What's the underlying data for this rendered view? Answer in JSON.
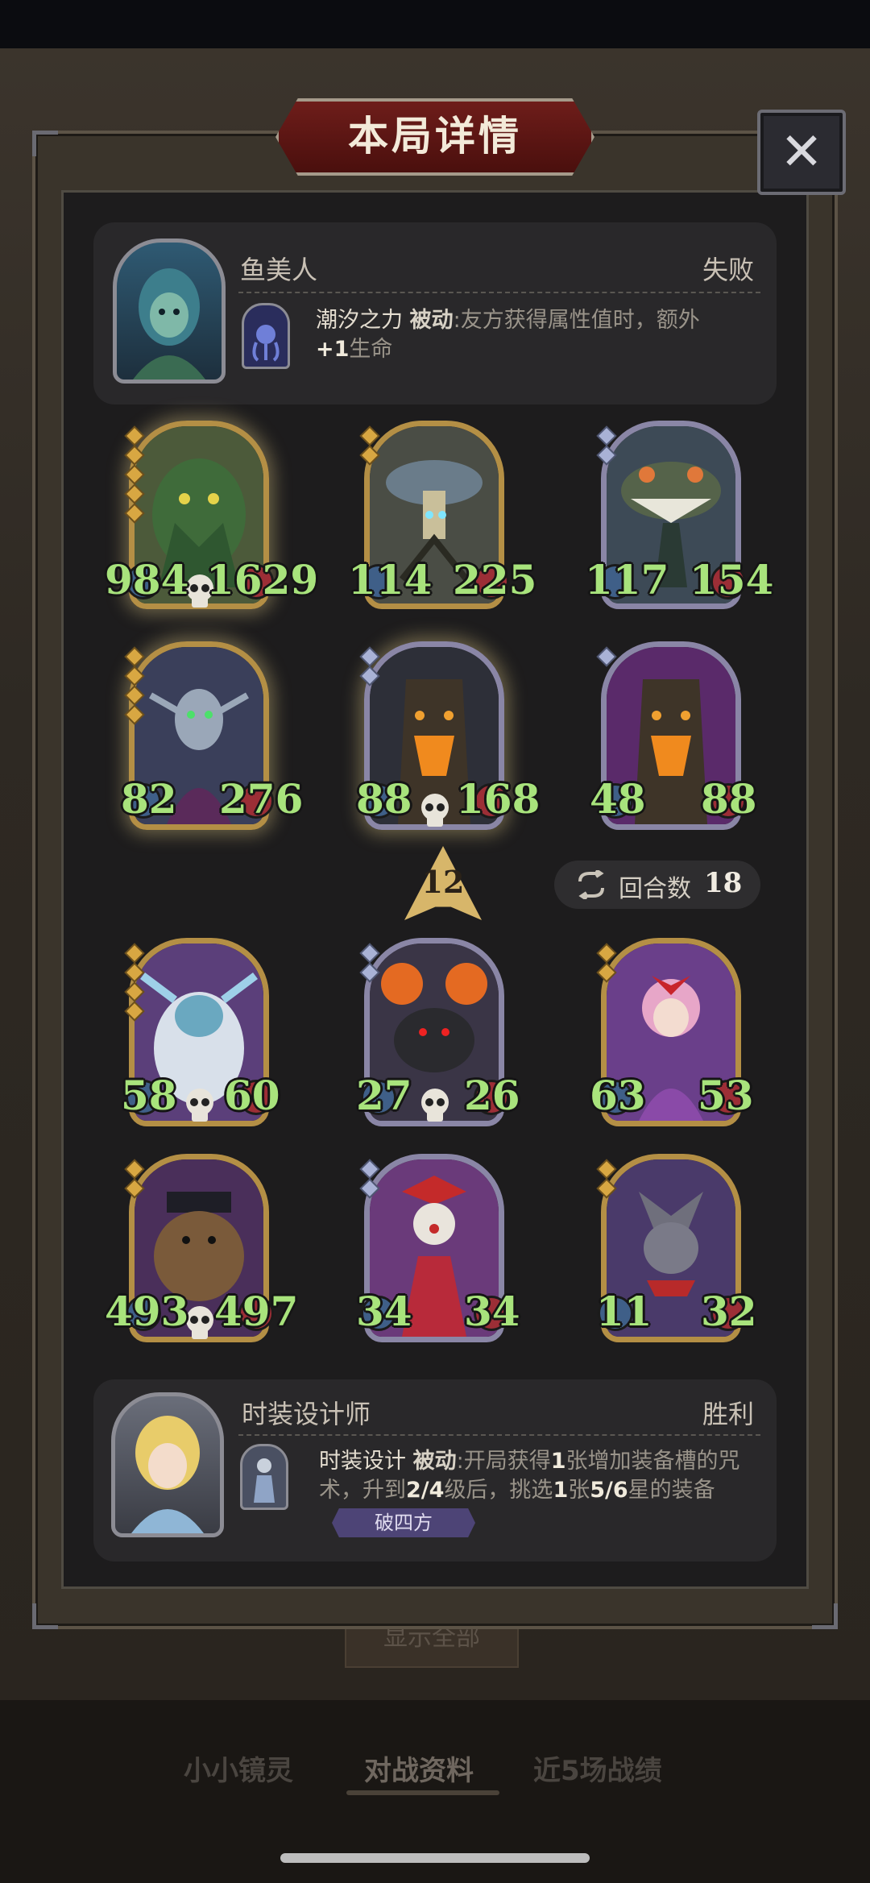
{
  "title": "本局详情",
  "close_icon": "close-icon",
  "top_player": {
    "name": "鱼美人",
    "result": "失败",
    "skill_name": "潮汐之力",
    "skill_type": "被动",
    "skill_desc_1": ":友方获得属性值时，额外",
    "skill_desc_2_hl": "+1",
    "skill_desc_2": "生命"
  },
  "top_units": [
    {
      "atk": "984",
      "hp": "1629"
    },
    {
      "atk": "114",
      "hp": "225"
    },
    {
      "atk": "117",
      "hp": "154"
    },
    {
      "atk": "82",
      "hp": "276"
    },
    {
      "atk": "88",
      "hp": "168"
    },
    {
      "atk": "48",
      "hp": "88"
    }
  ],
  "turn": {
    "number": "12",
    "round_label": "回合数",
    "round_value": "18"
  },
  "bottom_units": [
    {
      "atk": "58",
      "hp": "60"
    },
    {
      "atk": "27",
      "hp": "26"
    },
    {
      "atk": "63",
      "hp": "53"
    },
    {
      "atk": "493",
      "hp": "497"
    },
    {
      "atk": "34",
      "hp": "34"
    },
    {
      "atk": "11",
      "hp": "32"
    }
  ],
  "bottom_player": {
    "name": "时装设计师",
    "result": "胜利",
    "skill_name": "时装设计",
    "skill_type": "被动",
    "skill_desc_1a": ":开局获得",
    "skill_desc_1b": "1",
    "skill_desc_1c": "张增加装备槽的咒",
    "skill_desc_2a": "术，升到",
    "skill_desc_2b": "2/4",
    "skill_desc_2c": "级后，挑选",
    "skill_desc_2d": "1",
    "skill_desc_2e": "张",
    "skill_desc_2f": "5/6",
    "skill_desc_2g": "星的装备",
    "tag": "破四方"
  },
  "behind_button": "显示全部",
  "nav": {
    "tab1": "小小镜灵",
    "tab2": "对战资料",
    "tab3": "近5场战绩"
  },
  "colors": {
    "stat_green": "#a8e37c",
    "banner_red": "#6e1d1a",
    "gold_frame": "#b48f45",
    "silver_frame": "#8a86a6"
  }
}
